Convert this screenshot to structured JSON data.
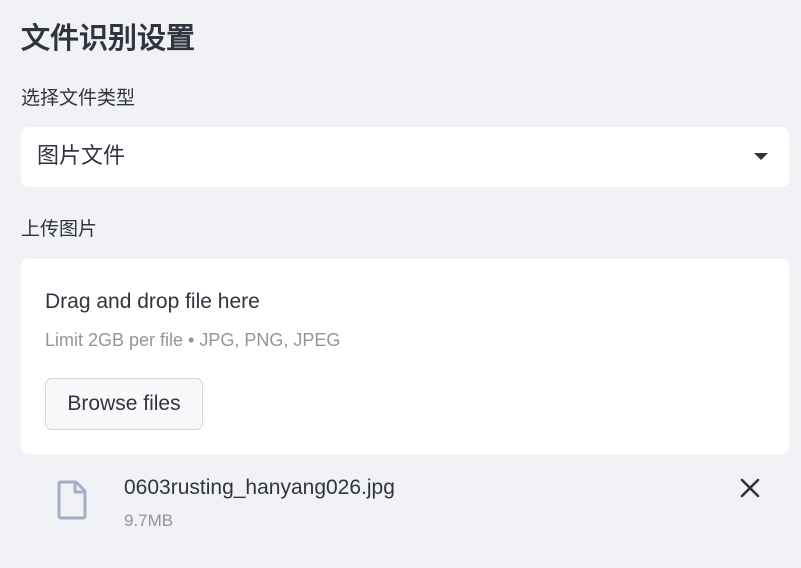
{
  "header": {
    "title": "文件识别设置"
  },
  "file_type": {
    "label": "选择文件类型",
    "selected": "图片文件",
    "icon": "chevron-down-icon"
  },
  "upload": {
    "label": "上传图片",
    "drop_title": "Drag and drop file here",
    "drop_hint": "Limit 2GB per file • JPG, PNG, JPEG",
    "browse_label": "Browse files"
  },
  "uploaded_file": {
    "name": "0603rusting_hanyang026.jpg",
    "size": "9.7MB",
    "icon": "file-icon",
    "remove_icon": "close-icon"
  },
  "colors": {
    "background": "#f0f2f6",
    "text": "#31333f",
    "muted_text": "#93959c",
    "file_icon": "#a3afc7"
  }
}
